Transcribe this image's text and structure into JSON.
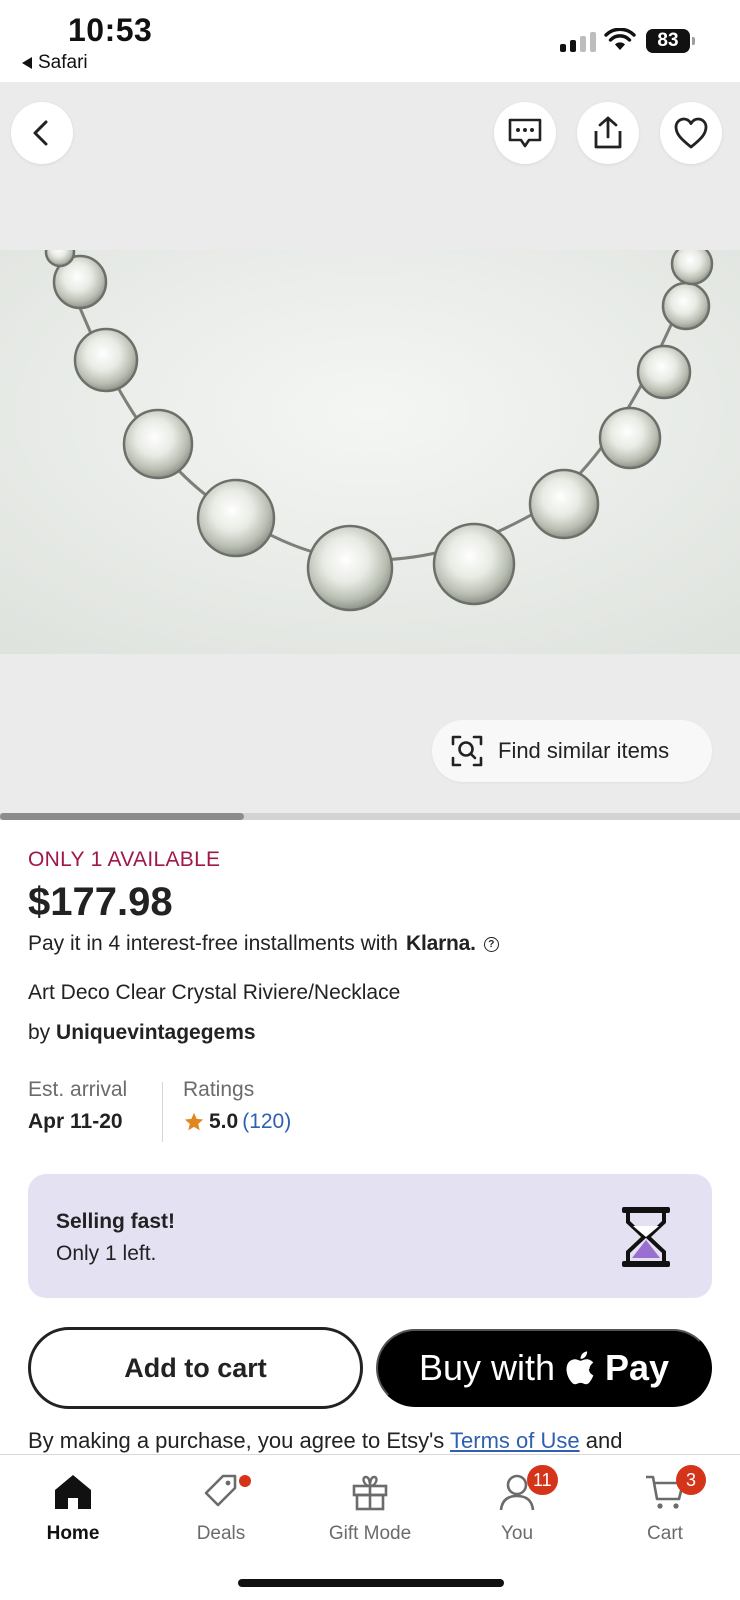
{
  "status_bar": {
    "time": "10:53",
    "back_app": "Safari",
    "battery": "83"
  },
  "gallery": {
    "find_similar_label": "Find similar items",
    "image_index_fraction": 0.33,
    "icons": [
      "back-icon",
      "message-icon",
      "share-icon",
      "heart-icon"
    ]
  },
  "listing": {
    "availability": "ONLY 1 AVAILABLE",
    "price": "$177.98",
    "installments_text": "Pay it in 4 interest-free installments with",
    "installments_provider": "Klarna.",
    "title": "Art Deco Clear Crystal Riviere/Necklace",
    "by_prefix": "by",
    "shop_name": "Uniquevintagegems"
  },
  "meta": {
    "arrival_label": "Est. arrival",
    "arrival_value": "Apr 11-20",
    "ratings_label": "Ratings",
    "rating_score": "5.0",
    "rating_count": "(120)"
  },
  "notice": {
    "title": "Selling fast!",
    "subtitle": "Only 1 left."
  },
  "actions": {
    "add_to_cart": "Add to cart",
    "buy_with": "Buy with",
    "pay": "Pay"
  },
  "legal": {
    "prefix": "By making a purchase, you agree to Etsy's",
    "link": "Terms of Use",
    "suffix": "and"
  },
  "tabs": [
    {
      "label": "Home",
      "icon": "home-icon",
      "active": true
    },
    {
      "label": "Deals",
      "icon": "tag-icon",
      "dot": true
    },
    {
      "label": "Gift Mode",
      "icon": "gift-icon"
    },
    {
      "label": "You",
      "icon": "user-icon",
      "badge": "11"
    },
    {
      "label": "Cart",
      "icon": "cart-icon",
      "badge": "3"
    }
  ],
  "colors": {
    "availability": "#a0174a",
    "link": "#2f5fb3",
    "badge": "#d4341a",
    "notice_bg": "#e4e1f2",
    "star": "#e0871f"
  }
}
